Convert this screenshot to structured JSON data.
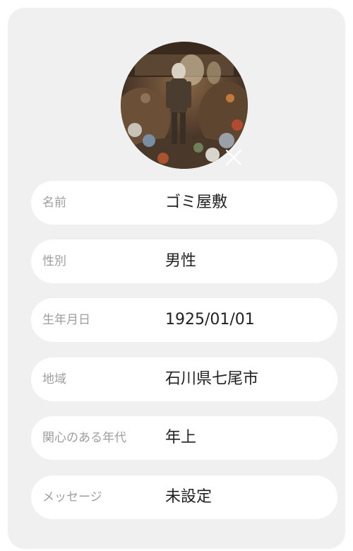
{
  "profile": {
    "avatar_icon": "user-photo",
    "close_icon": "close-icon",
    "fields": [
      {
        "label": "名前",
        "value": "ゴミ屋敷"
      },
      {
        "label": "性別",
        "value": "男性"
      },
      {
        "label": "生年月日",
        "value": "1925/01/01"
      },
      {
        "label": "地域",
        "value": "石川県七尾市"
      },
      {
        "label": "関心のある年代",
        "value": "年上"
      },
      {
        "label": "メッセージ",
        "value": "未設定"
      }
    ]
  },
  "colors": {
    "card_background": "#f0f0f0",
    "row_background": "#ffffff",
    "label_text": "#9e9e9e",
    "value_text": "#222222"
  }
}
